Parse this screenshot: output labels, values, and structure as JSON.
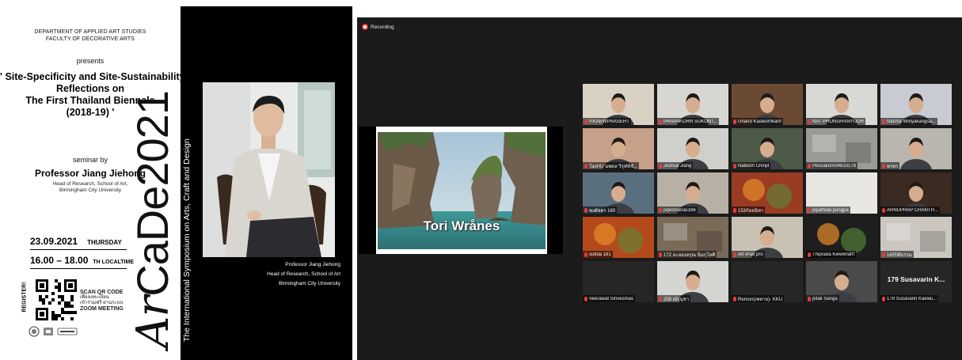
{
  "poster": {
    "department": "DEPARTMENT OF APPLIED ART STUDIES",
    "faculty": "FACULTY OF DECORATIVE ARTS",
    "presents": "presents",
    "title_lines": [
      "' Site-Specificity and Site-Sustainability:",
      "Reflections on",
      "The First Thailand Biennale",
      "(2018-19) '"
    ],
    "seminar_by": "seminar by",
    "speaker": "Professor Jiang Jiehong",
    "speaker_role_lines": [
      "Head of Research, School of Art,",
      "Birmingham City University"
    ],
    "date": "23.09.2021",
    "weekday": "THURSDAY",
    "time": "16.00 – 18.00",
    "timezone": "TH LOCALTIME",
    "register_label": "REGISTER!",
    "qr_lines": [
      "SCAN QR CODE",
      "เพื่อลงทะเบียน",
      "เข้าร่วมฟรี ผ่านระบบ",
      "ZOOM MEETING"
    ],
    "brand_ar": "Ar",
    "brand_cade": "CaDe",
    "brand_year": "2021",
    "symposium": "The International Symposium on Arts, Craft and Design",
    "portrait_caption_lines": [
      "Professor Jiang Jiehong",
      "Head of Research, School of Art",
      "Birmingham City University"
    ],
    "colors": {
      "background": "#ffffff",
      "dark_panel": "#000000",
      "text": "#111111"
    }
  },
  "zoom": {
    "recording_label": "Recording",
    "shared_slide_caption": "Tori Wrånes",
    "participants": [
      {
        "name": "P.KAEWPRASERT",
        "row": 0,
        "col": 0,
        "face": "person",
        "bg": "#d9d2c4"
      },
      {
        "name": "PRAPAKORN SUKONT...",
        "row": 0,
        "col": 1,
        "face": "person",
        "bg": "#d8d6d2"
      },
      {
        "name": "Unarut Kasikornkarn",
        "row": 0,
        "col": 2,
        "face": "person",
        "bg": "#6b4a33"
      },
      {
        "name": "NAT PHONGHANYUDH",
        "row": 0,
        "col": 3,
        "face": "person",
        "bg": "#d8d8d4",
        "active": true
      },
      {
        "name": "Natcha Wiriyakangsa...",
        "row": 0,
        "col": 4,
        "face": "person",
        "bg": "#c8ccd2"
      },
      {
        "name": "TaoHU นพดล วิรุฬห์ชั...",
        "row": 1,
        "col": 0,
        "face": "person",
        "bg": "#c7a089"
      },
      {
        "name": "Joshua Jiang",
        "row": 1,
        "col": 1,
        "face": "person",
        "bg": "#cfcfcb"
      },
      {
        "name": "Natkorn Chinjit",
        "row": 1,
        "col": 2,
        "face": "person",
        "bg": "#4e5a48"
      },
      {
        "name": "Pessakorn04610178",
        "row": 1,
        "col": 3,
        "face": "room",
        "bg": "#9a9a96"
      },
      {
        "name": "พรพร",
        "row": 1,
        "col": 4,
        "face": "person",
        "bg": "#b8b6ae"
      },
      {
        "name": "พงศ์สตร 160",
        "row": 2,
        "col": 0,
        "face": "person",
        "bg": "#5a6f7e"
      },
      {
        "name": "pipinmanas166",
        "row": 2,
        "col": 1,
        "face": "person",
        "bg": "#b7b0a4"
      },
      {
        "name": "153กัลยนิชา",
        "row": 2,
        "col": 2,
        "face": "nature",
        "bg": "#9a3b24"
      },
      {
        "name": "piyathida pongpa",
        "row": 2,
        "col": 3,
        "face": "blank",
        "bg": "#e8e6e3"
      },
      {
        "name": "ARNUPHAP CHANTH...",
        "row": 2,
        "col": 4,
        "face": "person",
        "bg": "#3a2a22"
      },
      {
        "name": "sutida 181",
        "row": 3,
        "col": 0,
        "face": "nature",
        "bg": "#b44a1c"
      },
      {
        "name": "172 ละอองอรุณ นิ่มกุโลศิ",
        "row": 3,
        "col": 1,
        "face": "room",
        "bg": "#7a6a58"
      },
      {
        "name": "Art iPad pro",
        "row": 3,
        "col": 2,
        "face": "person",
        "bg": "#c9c2b4"
      },
      {
        "name": "Thiprada Kiewkham",
        "row": 3,
        "col": 3,
        "face": "nature",
        "bg": "#1e1e1e"
      },
      {
        "name": "165ปิติธรรม",
        "row": 3,
        "col": 4,
        "face": "room",
        "bg": "#cbc7c0"
      },
      {
        "name": "Veerawat Sirivesmas",
        "row": 4,
        "col": 0,
        "face": "blank",
        "bg": "#262626"
      },
      {
        "name": "258 ณัฐนุชา",
        "row": 4,
        "col": 1,
        "face": "person",
        "bg": "#d4d4d0"
      },
      {
        "name": "Remon(เพทาย)- KKU",
        "row": 4,
        "col": 2,
        "face": "blank",
        "bg": "#262626"
      },
      {
        "name": "pitak Sanga",
        "row": 4,
        "col": 3,
        "face": "person",
        "bg": "#4a4a4a"
      },
      {
        "name": "179 Susavarin Kaewu...",
        "row": 4,
        "col": 4,
        "face": "blank",
        "bg": "#262626",
        "display_name": "179 Susavarin K..."
      }
    ],
    "colors": {
      "background": "#1b1b1b",
      "tile_bg": "#2a2a2a",
      "active_speaker": "#b8d334",
      "recording": "#e23b3b"
    }
  }
}
